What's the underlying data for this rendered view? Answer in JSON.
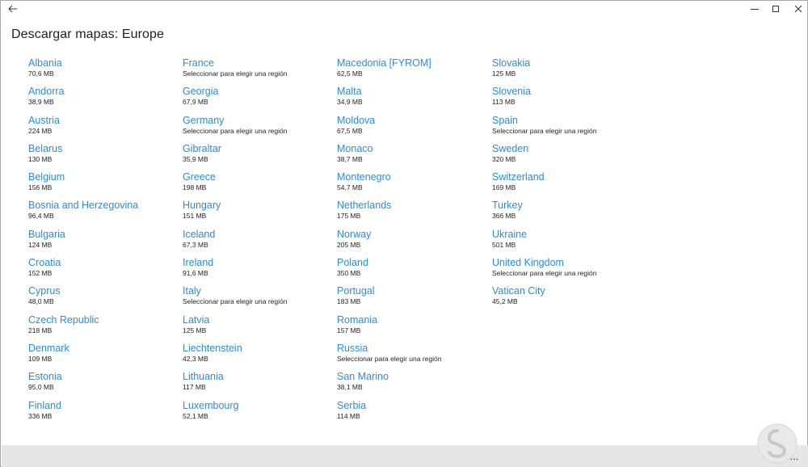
{
  "window": {
    "back_icon": "back-arrow-icon",
    "minimize_icon": "minimize-icon",
    "maximize_icon": "maximize-icon",
    "close_icon": "close-icon"
  },
  "page": {
    "title": "Descargar mapas: Europe"
  },
  "columns": [
    [
      {
        "name": "Albania",
        "size": "70,6 MB"
      },
      {
        "name": "Andorra",
        "size": "38,9 MB"
      },
      {
        "name": "Austria",
        "size": "224 MB"
      },
      {
        "name": "Belarus",
        "size": "130 MB"
      },
      {
        "name": "Belgium",
        "size": "156 MB"
      },
      {
        "name": "Bosnia and Herzegovina",
        "size": "96,4 MB"
      },
      {
        "name": "Bulgaria",
        "size": "124 MB"
      },
      {
        "name": "Croatia",
        "size": "152 MB"
      },
      {
        "name": "Cyprus",
        "size": "48,0 MB"
      },
      {
        "name": "Czech Republic",
        "size": "218 MB"
      },
      {
        "name": "Denmark",
        "size": "109 MB"
      },
      {
        "name": "Estonia",
        "size": "95,0 MB"
      },
      {
        "name": "Finland",
        "size": "336 MB"
      }
    ],
    [
      {
        "name": "France",
        "size": "Seleccionar para elegir una región"
      },
      {
        "name": "Georgia",
        "size": "67,9 MB"
      },
      {
        "name": "Germany",
        "size": "Seleccionar para elegir una región"
      },
      {
        "name": "Gibraltar",
        "size": "35,9 MB"
      },
      {
        "name": "Greece",
        "size": "198 MB"
      },
      {
        "name": "Hungary",
        "size": "151 MB"
      },
      {
        "name": "Iceland",
        "size": "67,3 MB"
      },
      {
        "name": "Ireland",
        "size": "91,6 MB"
      },
      {
        "name": "Italy",
        "size": "Seleccionar para elegir una región"
      },
      {
        "name": "Latvia",
        "size": "125 MB"
      },
      {
        "name": "Liechtenstein",
        "size": "42,3 MB"
      },
      {
        "name": "Lithuania",
        "size": "117 MB"
      },
      {
        "name": "Luxembourg",
        "size": "52,1 MB"
      }
    ],
    [
      {
        "name": "Macedonia [FYROM]",
        "size": "62,5 MB"
      },
      {
        "name": "Malta",
        "size": "34,9 MB"
      },
      {
        "name": "Moldova",
        "size": "67,5 MB"
      },
      {
        "name": "Monaco",
        "size": "38,7 MB"
      },
      {
        "name": "Montenegro",
        "size": "54,7 MB"
      },
      {
        "name": "Netherlands",
        "size": "175 MB"
      },
      {
        "name": "Norway",
        "size": "205 MB"
      },
      {
        "name": "Poland",
        "size": "350 MB"
      },
      {
        "name": "Portugal",
        "size": "183 MB"
      },
      {
        "name": "Romania",
        "size": "157 MB"
      },
      {
        "name": "Russia",
        "size": "Seleccionar para elegir una región"
      },
      {
        "name": "San Marino",
        "size": "38,1 MB"
      },
      {
        "name": "Serbia",
        "size": "114 MB"
      }
    ],
    [
      {
        "name": "Slovakia",
        "size": "125 MB"
      },
      {
        "name": "Slovenia",
        "size": "113 MB"
      },
      {
        "name": "Spain",
        "size": "Seleccionar para elegir una región"
      },
      {
        "name": "Sweden",
        "size": "320 MB"
      },
      {
        "name": "Switzerland",
        "size": "169 MB"
      },
      {
        "name": "Turkey",
        "size": "366 MB"
      },
      {
        "name": "Ukraine",
        "size": "501 MB"
      },
      {
        "name": "United Kingdom",
        "size": "Seleccionar para elegir una región"
      },
      {
        "name": "Vatican City",
        "size": "45,2 MB"
      }
    ]
  ],
  "bottom_bar": {
    "more_label": "...",
    "more_icon": "more-options-icon"
  },
  "colors": {
    "link": "#2d8cd8",
    "text": "#1f1f1f",
    "bottom_bar": "#e6e6e6"
  }
}
